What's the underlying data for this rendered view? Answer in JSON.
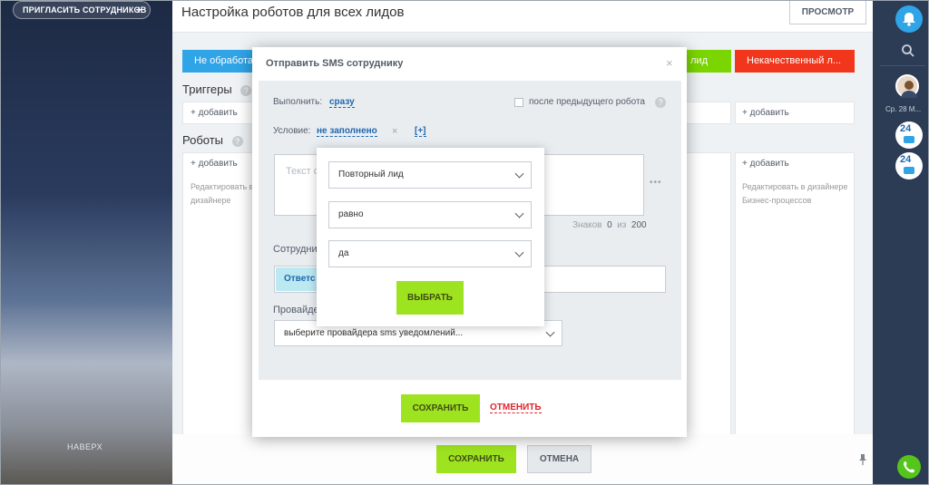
{
  "topbar": {
    "invite_label": "ПРИГЛАСИТЬ СОТРУДНИКОВ",
    "invite_plus": "+"
  },
  "page": {
    "title": "Настройка роботов для всех лидов",
    "preview_label": "ПРОСМОТР"
  },
  "stages": [
    {
      "label": "Не обработан",
      "color": "#2fa4e7"
    },
    {
      "label": "лид",
      "color": "#7bd500"
    },
    {
      "label": "Некачественный л...",
      "color": "#f1361b"
    }
  ],
  "triggers": {
    "label": "Триггеры",
    "help": "?",
    "add_label": "+ добавить",
    "add_label_right": "+ добавить"
  },
  "robots": {
    "label": "Роботы",
    "help": "?",
    "add_label": "+ добавить",
    "add_label_right": "+ добавить",
    "designer_left": "Редактировать в дизайнере Бизнес-процессов",
    "designer_right": "Редактировать в дизайнере Бизнес-процессов"
  },
  "modal": {
    "title": "Отправить SMS сотруднику",
    "close": "×",
    "execute_label": "Выполнить:",
    "execute_value": "сразу",
    "after_previous_label": "после предыдущего робота",
    "help": "?",
    "condition_label": "Условие:",
    "condition_value": "не заполнено",
    "condition_remove": "×",
    "condition_add": "[+]",
    "text_placeholder": "Текст с",
    "counter_label": "Знаков",
    "counter_value": "0",
    "counter_of": "из",
    "counter_max": "200",
    "more": "•••",
    "employee_label": "Сотрудни",
    "employee_chip": "Ответс",
    "provider_label": "Провайде",
    "provider_select": "выберите провайдера sms уведомлений...",
    "save_label": "СОХРАНИТЬ",
    "cancel_label": "ОТМЕНИТЬ"
  },
  "condition_popup": {
    "field_select": "Повторный лид",
    "operator_select": "равно",
    "value_select": "да",
    "choose_label": "ВЫБРАТЬ"
  },
  "footer": {
    "up_label": "НАВЕРХ",
    "save_label": "СОХРАНИТЬ",
    "cancel_label": "ОТМЕНА",
    "pin_icon": "pin-icon"
  },
  "sidebar_right": {
    "date_label": "Ср. 28 М...",
    "badge_24": "24"
  },
  "colors": {
    "accent_green": "#9ee320",
    "link_blue": "#2067b0",
    "cancel_red": "#e0252c",
    "stage_blue": "#2fa4e7",
    "stage_green": "#7bd500",
    "stage_red": "#f1361b"
  }
}
